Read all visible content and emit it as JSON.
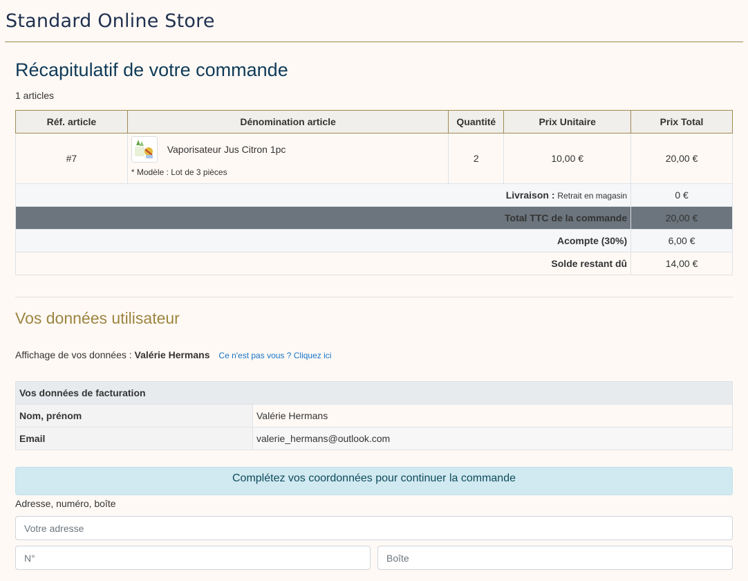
{
  "header": {
    "store_title": "Standard Online Store"
  },
  "summary": {
    "title": "Récapitulatif de votre commande",
    "count": "1 articles",
    "columns": [
      "Réf. article",
      "Dénomination article",
      "Quantité",
      "Prix Unitaire",
      "Prix Total"
    ],
    "item": {
      "ref": "#7",
      "name": "Vaporisateur Jus Citron 1pc",
      "model": "* Modèle : Lot de 3 pièces",
      "qty": "2",
      "unit_price": "10,00 €",
      "total_price": "20,00 €",
      "thumb_icon": "product-thumbnail-icon"
    },
    "delivery": {
      "label": "Livraison :",
      "detail": "Retrait en magasin",
      "value": "0 €"
    },
    "total": {
      "label": "Total TTC de la commande",
      "value": "20,00 €"
    },
    "deposit": {
      "label": "Acompte (30%)",
      "value": "6,00 €"
    },
    "balance": {
      "label": "Solde restant dû",
      "value": "14,00 €"
    }
  },
  "user": {
    "title": "Vos données utilisateur",
    "display_prefix": "Affichage de vos données :",
    "display_name": "Valérie Hermans",
    "not_you_link": "Ce n'est pas vous ? Cliquez ici",
    "billing": {
      "heading": "Vos données de facturation",
      "name_label": "Nom, prénom",
      "name_value": "Valérie Hermans",
      "email_label": "Email",
      "email_value": "valerie_hermans@outlook.com"
    }
  },
  "address": {
    "alert": "Complétez vos coordonnées pour continuer la commande",
    "label": "Adresse, numéro, boîte",
    "address_placeholder": "Votre adresse",
    "number_placeholder": "N°",
    "box_placeholder": "Boîte"
  },
  "colors": {
    "accent_gold": "#9c8540",
    "title_blue": "#0f3b58",
    "total_row": "#6c757d",
    "alert_bg": "#d1e9f0"
  }
}
